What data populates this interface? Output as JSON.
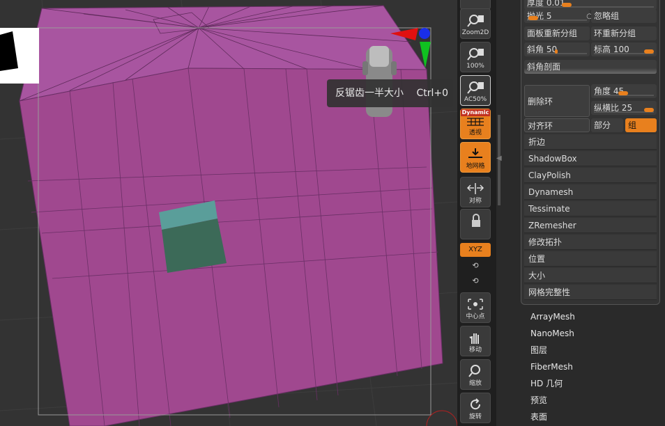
{
  "toolbar": {
    "zoom2d": "Zoom2D",
    "pct100": "100%",
    "ac50": "AC50%",
    "dynamic": "Dynamic",
    "perspective": "透视",
    "floor": "地网格",
    "symmetry": "对称",
    "xyz": "XYZ",
    "center": "中心点",
    "move": "移动",
    "scale": "缩放",
    "rotate": "旋转"
  },
  "tooltip": {
    "text": "反锯齿一半大小",
    "shortcut": "Ctrl+0"
  },
  "panel": {
    "thickness_label": "厚度 0.01",
    "polish_label": "抛光 5",
    "ignore_groups": "忽略组",
    "panel_regroup": "面板重新分组",
    "loop_regroup": "环重新分组",
    "bevel_label": "斜角 50",
    "elevation_label": "标高 100",
    "bevel_profile": "斜角剖面",
    "delete_loops": "删除环",
    "angle_label": "角度 45",
    "aspect_label": "纵横比 25",
    "align_loops": "对齐环",
    "partial": "部分",
    "groups": "组",
    "items": [
      "折边",
      "ShadowBox",
      "ClayPolish",
      "Dynamesh",
      "Tessimate",
      "ZRemesher",
      "修改拓扑",
      "位置",
      "大小",
      "网格完整性"
    ]
  },
  "subpalettes": [
    "ArrayMesh",
    "NanoMesh",
    "图层",
    "FiberMesh",
    "HD 几何",
    "预览",
    "表面"
  ],
  "colors": {
    "mesh": "#a0488f",
    "accent": "#e8801e",
    "cube_top": "#5a9e9a",
    "cube_front": "#3c6a58"
  }
}
